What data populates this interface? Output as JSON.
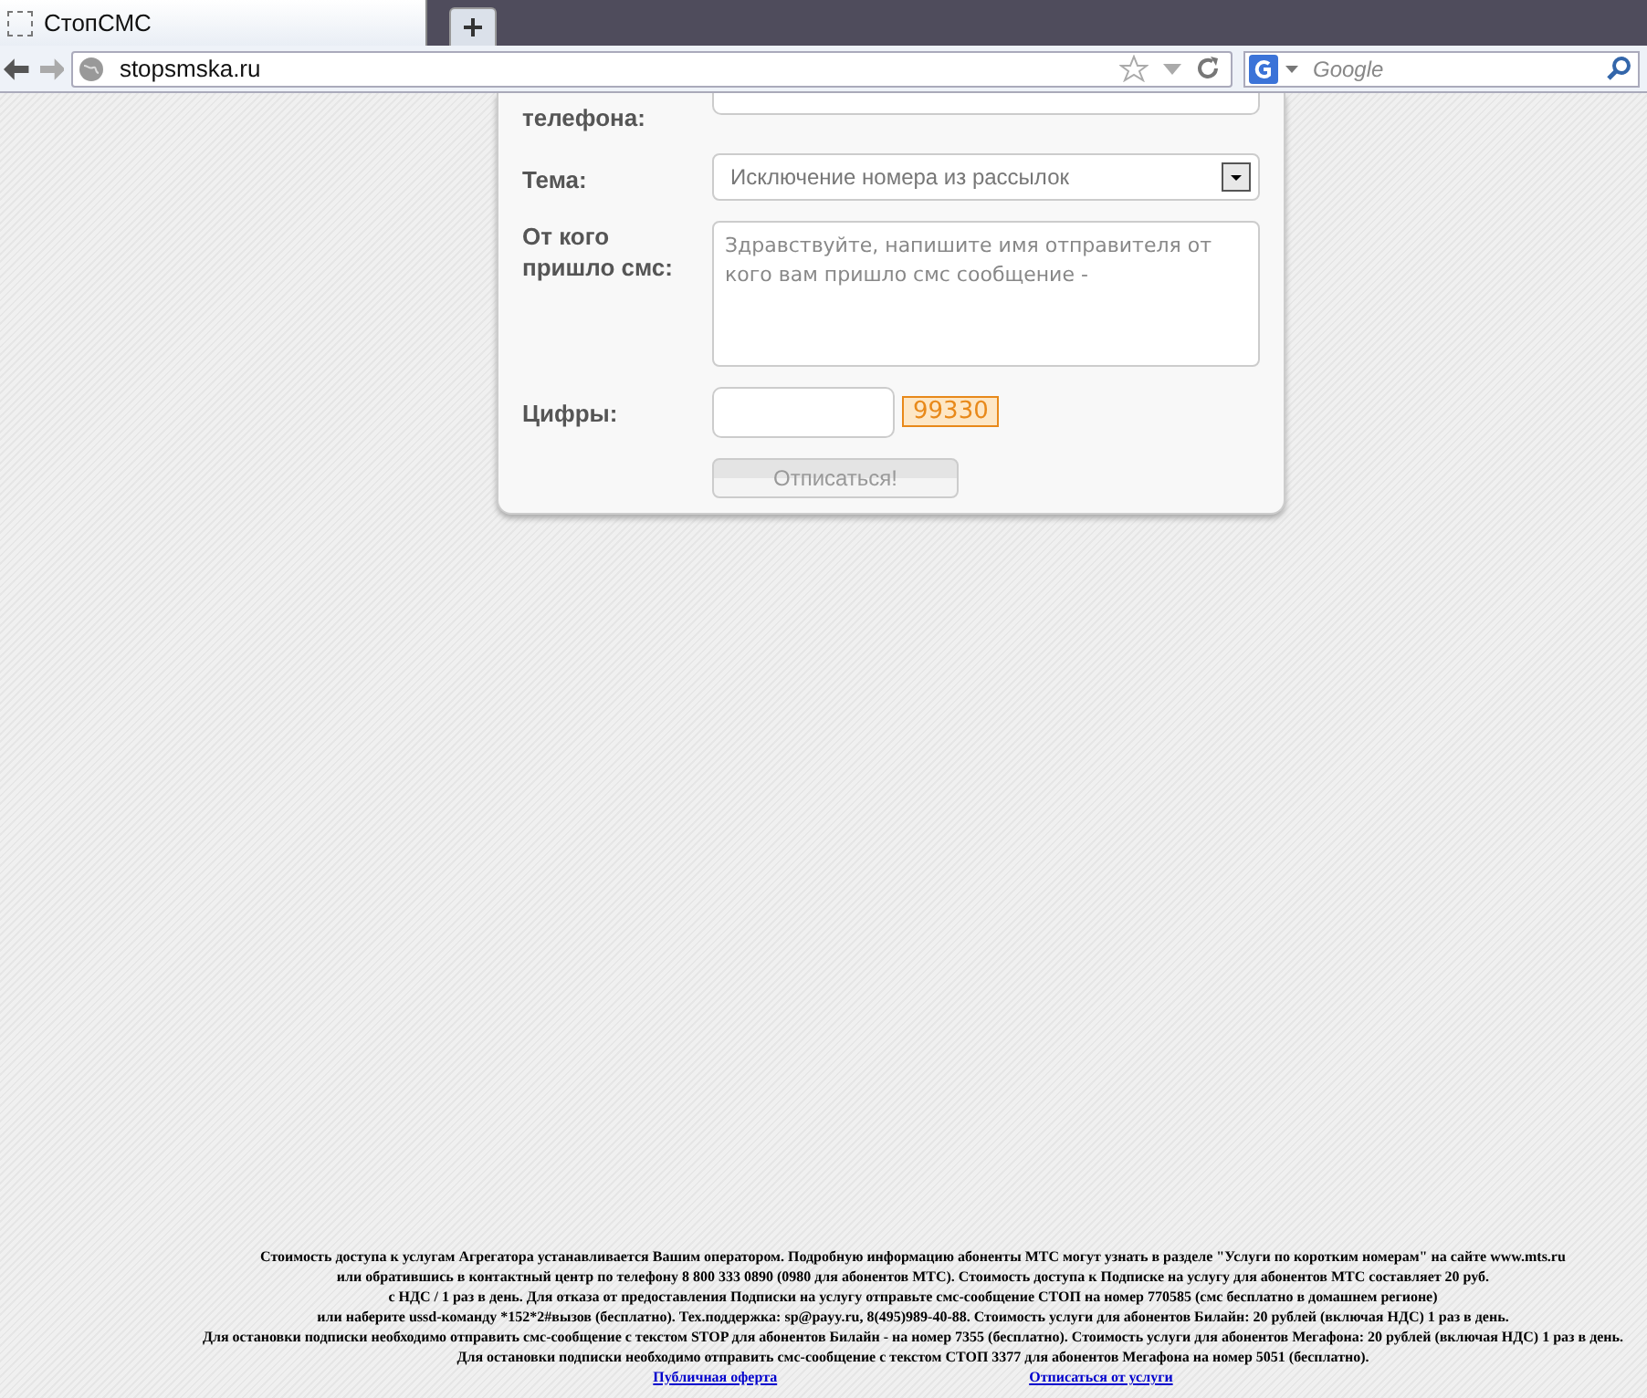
{
  "browser": {
    "tab_title": "СтопСМС",
    "url": "stopsmska.ru",
    "search_placeholder": "Google"
  },
  "form": {
    "phone_label": "телефона:",
    "topic": {
      "label": "Тема:",
      "value": "Исключение номера из рассылок"
    },
    "sender": {
      "label": "От кого пришло смс:",
      "placeholder": "Здравствуйте, напишите имя отправителя от кого вам пришло смс сообщение -"
    },
    "captcha": {
      "label": "Цифры:",
      "code": "99330"
    },
    "submit": {
      "label": "Отписаться!",
      "disabled": true
    }
  },
  "footer": {
    "lines": [
      "Стоимость доступа к услугам Агрегатора устанавливается Вашим оператором. Подробную информацию абоненты МТС могут узнать в разделе \"Услуги по коротким номерам\" на сайте www.mts.ru",
      "или обратившись в контактный центр по телефону 8 800 333 0890 (0980 для абонентов МТС). Стоимость доступа к Подписке на услугу для абонентов МТС составляет 20 руб.",
      "с НДС / 1 раз в день. Для отказа от предоставления Подписки на услугу отправьте смс-сообщение СТОП на номер 770585 (смс бесплатно в домашнем регионе)",
      "или наберите ussd-команду *152*2#вызов (бесплатно). Тех.поддержка: sp@payy.ru, 8(495)989-40-88. Стоимость услуги для абонентов Билайн: 20 рублей (включая НДС) 1 раз в день.",
      "Для остановки подписки необходимо отправить смс-сообщение с текстом STOP для абонентов Билайн - на номер 7355 (бесплатно). Стоимость услуги для абонентов Мегафона: 20 рублей (включая НДС) 1 раз в день.",
      "Для остановки подписки необходимо отправить смс-сообщение с текстом СТОП 3377 для абонентов Мегафона на номер 5051 (бесплатно)."
    ],
    "links": [
      "Публичная оферта",
      "Отписаться от услуги"
    ]
  }
}
